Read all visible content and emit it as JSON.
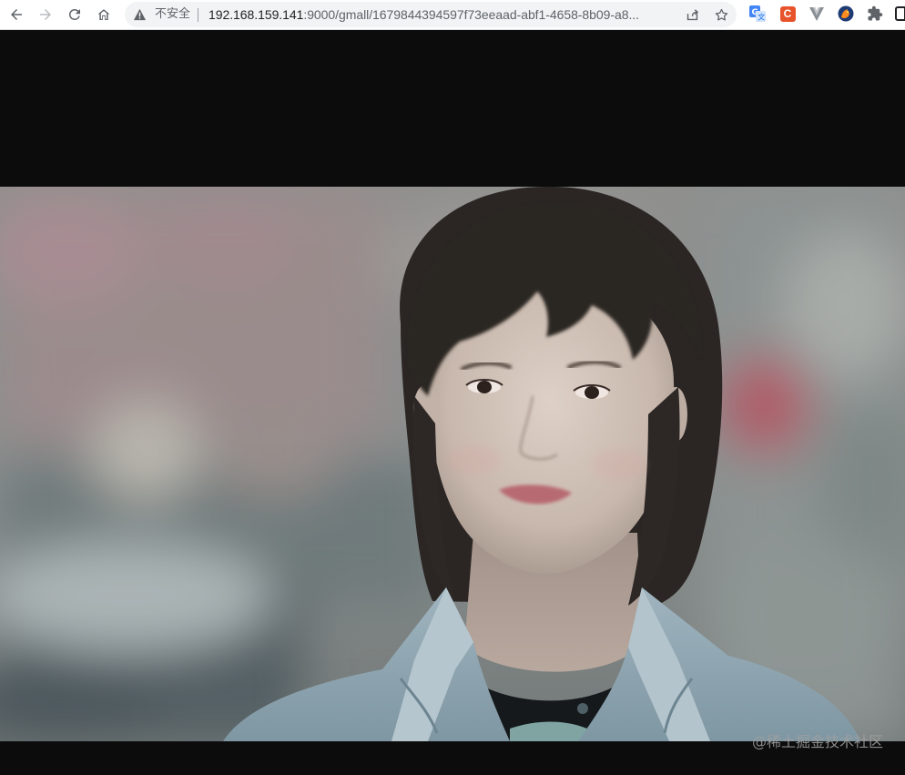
{
  "browser": {
    "security_label": "不安全",
    "url_host": "192.168.159.141",
    "url_rest": ":9000/gmall/1679844394597f73eeaad-abf1-4658-8b09-a8..."
  },
  "page": {
    "watermark": "@稀土掘金技术社区"
  },
  "colors": {
    "page_background": "#0c0c0d",
    "toolbar_background": "#ffffff",
    "omnibox_background": "#f1f3f4",
    "icon_color": "#5f6368"
  },
  "icons": [
    "back-arrow-icon",
    "forward-arrow-icon",
    "reload-icon",
    "home-icon",
    "warning-icon",
    "share-icon",
    "star-icon",
    "translate-extension-icon",
    "c-extension-icon",
    "v-extension-icon",
    "fox-extension-icon",
    "puzzle-extensions-icon",
    "side-panel-icon"
  ]
}
